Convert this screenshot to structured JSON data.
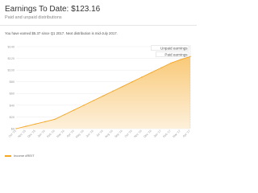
{
  "header": {
    "title": "Earnings To Date: $123.16",
    "subtitle": "Paid and unpaid distributions"
  },
  "info": "You have earned $5.37 since Q1 2017. Next distribution is mid-July 2017.",
  "colors": {
    "line": "#f5a623",
    "fill_top": "#f9c977",
    "fill_bottom": "#fdf0db",
    "grid": "#eeeeee",
    "axis_text": "#999999",
    "annotation_bg": "#ffffff"
  },
  "legend": {
    "label": "Income #REIT"
  },
  "chart_data": {
    "type": "area",
    "title": "",
    "xlabel": "",
    "ylabel": "",
    "x": [
      "Oct '15",
      "Nov '15",
      "Dec '15",
      "Jan '16",
      "Feb '16",
      "Mar '16",
      "Apr '16",
      "May '16",
      "Jun '16",
      "Jul '16",
      "Aug '16",
      "Sep '16",
      "Oct '16",
      "Nov '16",
      "Dec '16",
      "Jan '17",
      "Feb '17",
      "Mar '17",
      "Apr '17"
    ],
    "series": [
      {
        "name": "Income #REIT",
        "values": [
          0,
          4,
          8,
          12,
          16,
          24,
          32,
          40,
          48,
          56,
          64,
          72,
          80,
          88,
          96,
          104,
          112,
          118,
          123.16
        ]
      }
    ],
    "yticks": [
      "$0",
      "$20",
      "$40",
      "$60",
      "$80",
      "$100",
      "$120",
      "$140"
    ],
    "ylim": [
      0,
      140
    ],
    "grid": true,
    "legend": "bottom-left",
    "annotations": [
      {
        "label": "Unpaid earnings"
      },
      {
        "label": "Paid earnings"
      }
    ]
  }
}
